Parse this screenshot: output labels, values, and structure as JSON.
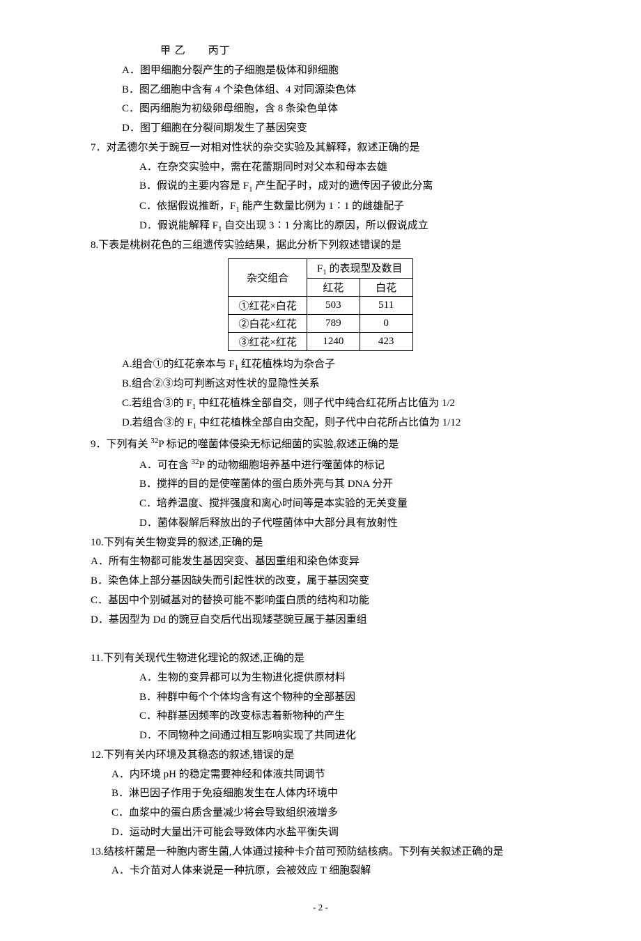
{
  "figLabels": "甲 乙　　丙丁",
  "q6": {
    "A": "A．图甲细胞分裂产生的子细胞是极体和卵细胞",
    "B": "B．图乙细胞中含有 4 个染色体组、4 对同源染色体",
    "C": "C．图丙细胞为初级卵母细胞，含 8 条染色单体",
    "D": "D．图丁细胞在分裂间期发生了基因突变"
  },
  "q7": {
    "stem": "7．对孟德尔关于豌豆一对相对性状的杂交实验及其解释，叙述正确的是",
    "A": "A．在杂交实验中，需在花蕾期同时对父本和母本去雄",
    "B_pre": "B．假说的主要内容是 F",
    "B_post": " 产生配子时，成对的遗传因子彼此分离",
    "C_pre": "C．依据假说推断，F",
    "C_post": " 能产生数量比例为 1∶1 的雌雄配子",
    "D_pre": "D．假说能解释 F",
    "D_post": " 自交出现 3∶1 分离比的原因，所以假说成立"
  },
  "q8": {
    "stem": "8.下表是桃树花色的三组遗传实验结果，据此分析下列叙述错误的是",
    "table": {
      "h1": "杂交组合",
      "h2_pre": "F",
      "h2_post": " 的表现型及数目",
      "col_red": "红花",
      "col_white": "白花",
      "rows": [
        {
          "cross": "①红花×白花",
          "red": "503",
          "white": "511"
        },
        {
          "cross": "②白花×红花",
          "red": "789",
          "white": "0"
        },
        {
          "cross": "③红花×红花",
          "red": "1240",
          "white": "423"
        }
      ]
    },
    "A_pre": "A.组合①的红花亲本与 F",
    "A_post": " 红花植株均为杂合子",
    "B": "B.组合②③均可判断这对性状的显隐性关系",
    "C_pre": "C.若组合③的 F",
    "C_post": " 中红花植株全部自交，则子代中纯合红花所占比值为 1/2",
    "D_pre": "D.若组合③的 F",
    "D_post": " 中红花植株全部自由交配，则子代中白花所占比值为 1/12"
  },
  "q9": {
    "stem_pre": "9．下列有关 ",
    "stem_iso": "32",
    "stem_post": "P 标记的噬菌体侵染无标记细菌的实验,叙述正确的是",
    "A_pre": "A．可在含 ",
    "A_iso": "32",
    "A_post": "P 的动物细胞培养基中进行噬菌体的标记",
    "B": "B．搅拌的目的是使噬菌体的蛋白质外壳与其 DNA 分开",
    "C": "C．培养温度、搅拌强度和离心时间等是本实验的无关变量",
    "D": "D．菌体裂解后释放出的子代噬菌体中大部分具有放射性"
  },
  "q10": {
    "stem": "10.下列有关生物变异的叙述,正确的是",
    "A": "A．所有生物都可能发生基因突变、基因重组和染色体变异",
    "B": "B．染色体上部分基因缺失而引起性状的改变，属于基因突变",
    "C": "C．基因中个别碱基对的替换可能不影响蛋白质的结构和功能",
    "D": "D．基因型为 Dd 的豌豆自交后代出现矮茎豌豆属于基因重组"
  },
  "q11": {
    "stem": "11.下列有关现代生物进化理论的叙述,正确的是",
    "A": "A．生物的变异都可以为生物进化提供原材料",
    "B": "B．种群中每个个体均含有这个物种的全部基因",
    "C": "C．种群基因频率的改变标志着新物种的产生",
    "D": "D．不同物种之间通过相互影响实现了共同进化"
  },
  "q12": {
    "stem": "12.下列有关内环境及其稳态的叙述,错误的是",
    "A": "A．内环境 pH 的稳定需要神经和体液共同调节",
    "B": "B．淋巴因子作用于免疫细胞发生在人体内环境中",
    "C": "C．血浆中的蛋白质含量减少将会导致组织液增多",
    "D": "D．运动时大量出汗可能会导致体内水盐平衡失调"
  },
  "q13": {
    "stem": "13.结核杆菌是一种胞内寄生菌,人体通过接种卡介苗可预防结核病。下列有关叙述正确的是",
    "A": "A．卡介苗对人体来说是一种抗原，会被效应 T 细胞裂解"
  },
  "pageNum": "- 2 -"
}
